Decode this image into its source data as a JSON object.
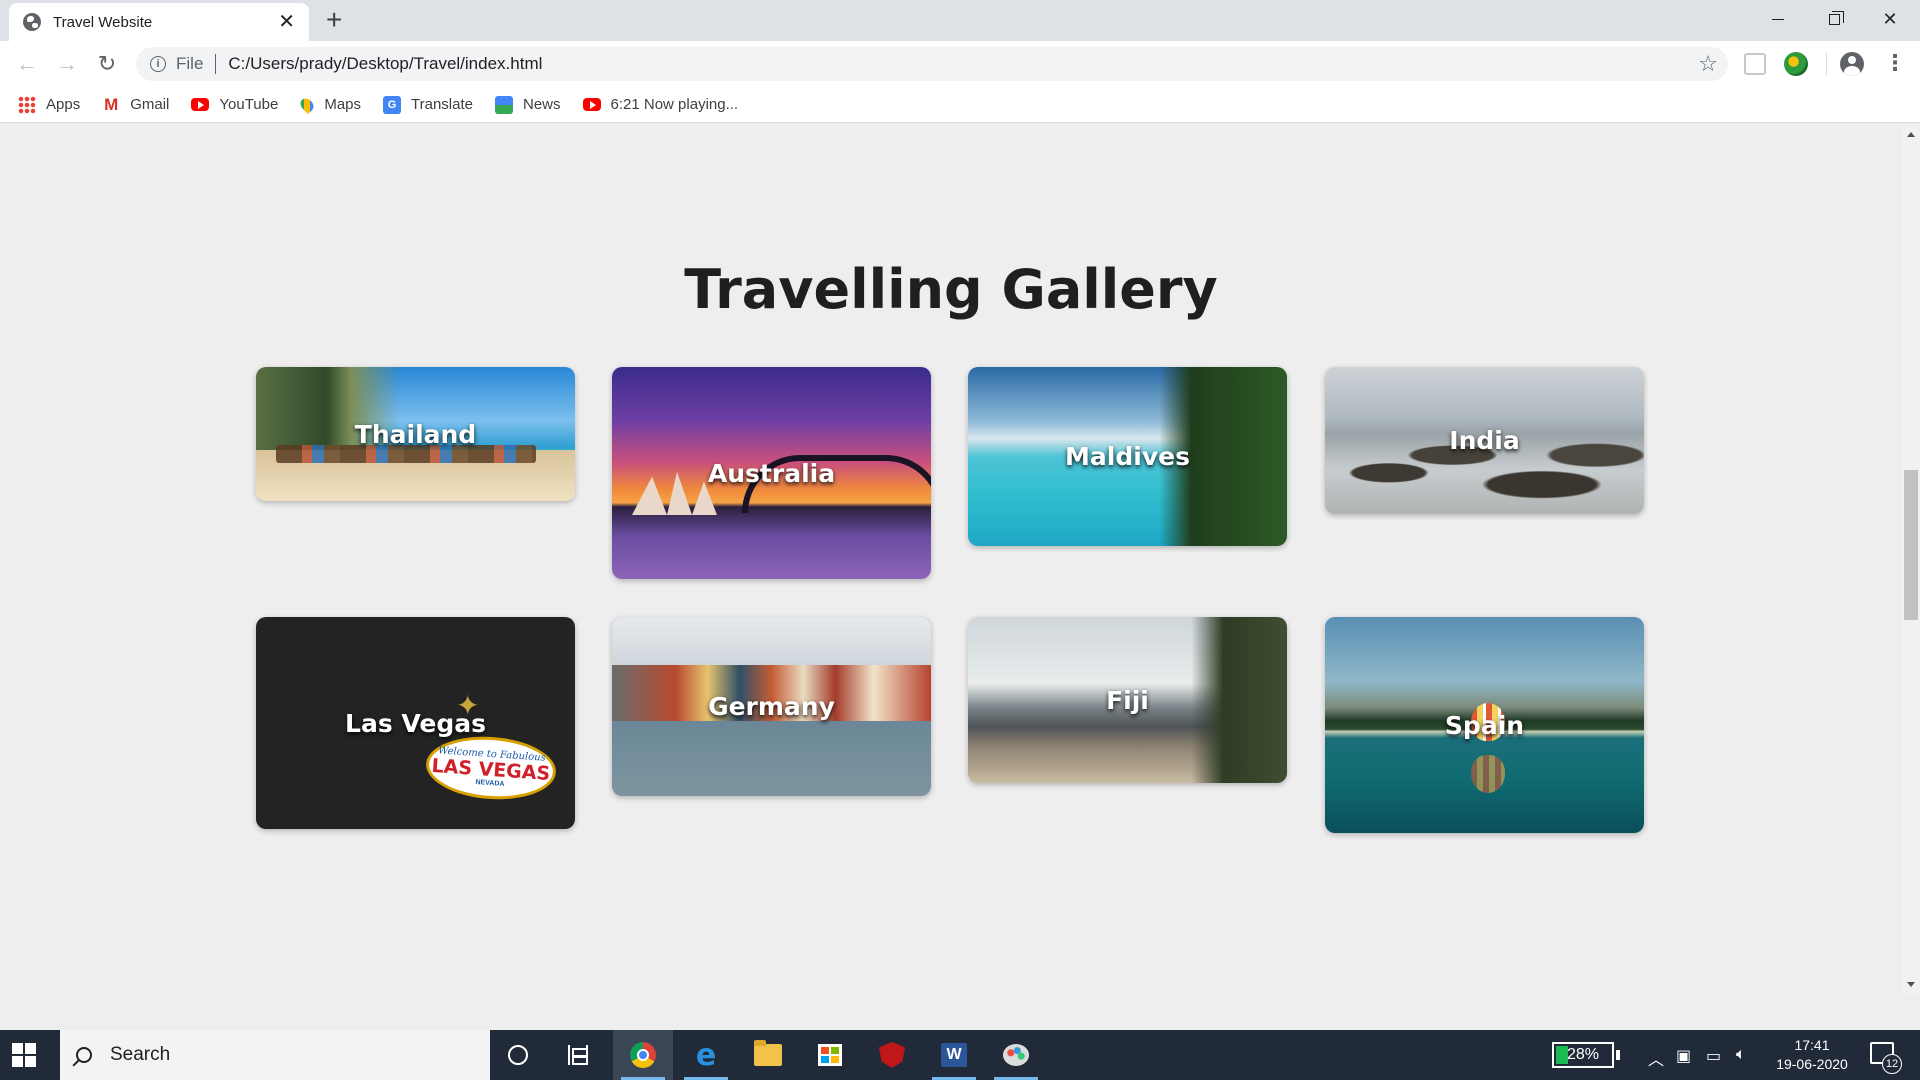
{
  "browser": {
    "tab_title": "Travel Website",
    "new_tab_symbol": "+",
    "close_symbol": "✕",
    "omnibox": {
      "scheme_label": "File",
      "url": "C:/Users/prady/Desktop/Travel/index.html"
    },
    "bookmarks": [
      {
        "label": "Apps",
        "icon": "apps-grid-icon"
      },
      {
        "label": "Gmail",
        "icon": "gmail-icon"
      },
      {
        "label": "YouTube",
        "icon": "youtube-icon"
      },
      {
        "label": "Maps",
        "icon": "maps-icon"
      },
      {
        "label": "Translate",
        "icon": "translate-icon"
      },
      {
        "label": "News",
        "icon": "news-icon"
      },
      {
        "label": "6:21 Now playing...",
        "icon": "youtube-icon"
      }
    ]
  },
  "page": {
    "gallery_title": "Travelling Gallery",
    "destinations": [
      {
        "name": "Thailand"
      },
      {
        "name": "Australia"
      },
      {
        "name": "Maldives"
      },
      {
        "name": "India"
      },
      {
        "name": "Las Vegas"
      },
      {
        "name": "Germany"
      },
      {
        "name": "Fiji"
      },
      {
        "name": "Spain"
      }
    ],
    "vegas_sign": {
      "line1": "Welcome to Fabulous",
      "line2": "LAS VEGAS",
      "line3": "NEVADA"
    }
  },
  "taskbar": {
    "search_text": "Search",
    "battery_percent": 28,
    "battery_label": "28%",
    "time": "17:41",
    "date": "19-06-2020",
    "notification_count": "12",
    "apps": [
      "chrome-icon",
      "edge-icon",
      "file-explorer-icon",
      "store-icon",
      "mcafee-icon",
      "word-icon",
      "paint-icon"
    ]
  },
  "colors": {
    "page_background": "#efeeee",
    "taskbar": "#202a38",
    "battery_fill": "#1db954"
  }
}
